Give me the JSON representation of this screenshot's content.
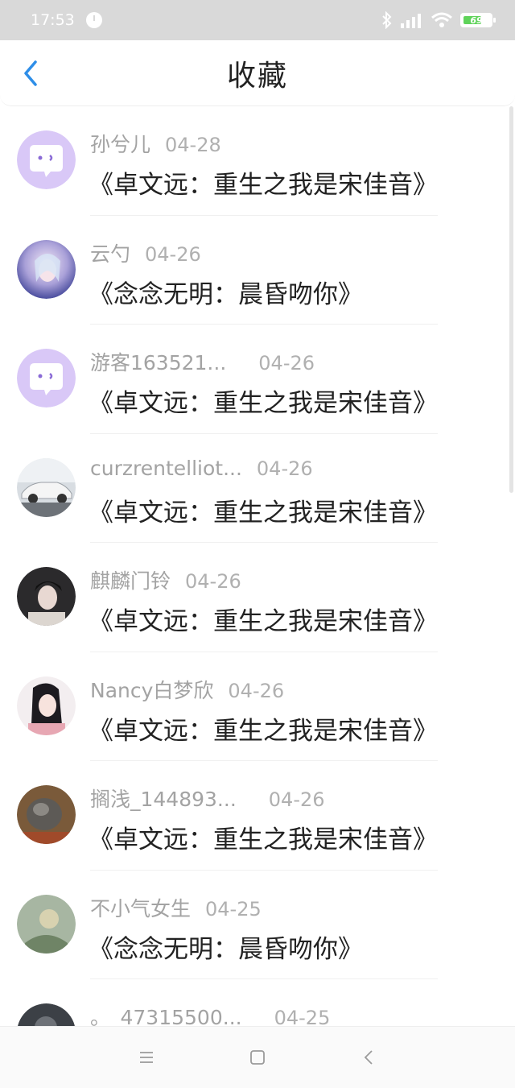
{
  "status_bar": {
    "time": "17:53",
    "battery": "69",
    "battery_level": 0.69
  },
  "header": {
    "title": "收藏"
  },
  "items": [
    {
      "user": "孙兮儿",
      "date": "04-28",
      "book": "《卓文远：重生之我是宋佳音》",
      "avatar": "default-avatar-icon"
    },
    {
      "user": "云勺",
      "date": "04-26",
      "book": "《念念无明：晨昏吻你》",
      "avatar": "fairy-avatar"
    },
    {
      "user": "游客163521...",
      "date": "04-26",
      "book": "《卓文远：重生之我是宋佳音》",
      "avatar": "default-avatar-icon"
    },
    {
      "user": "curzrentelliot...",
      "date": "04-26",
      "book": "《卓文远：重生之我是宋佳音》",
      "avatar": "car-avatar"
    },
    {
      "user": "麒麟门铃",
      "date": "04-26",
      "book": "《卓文远：重生之我是宋佳音》",
      "avatar": "portrait-avatar"
    },
    {
      "user": "Nancy白梦欣",
      "date": "04-26",
      "book": "《卓文远：重生之我是宋佳音》",
      "avatar": "illustration-avatar"
    },
    {
      "user": "搁浅_144893...",
      "date": "04-26",
      "book": "《卓文远：重生之我是宋佳音》",
      "avatar": "pet-avatar"
    },
    {
      "user": "不小气女生",
      "date": "04-25",
      "book": "《念念无明：晨昏吻你》",
      "avatar": "nature-avatar"
    },
    {
      "user": "。_47315500...",
      "date": "04-25",
      "book": "",
      "avatar": "dark-avatar"
    }
  ],
  "colors": {
    "accent": "#2e8ee8",
    "default_avatar": "#d9c8f7"
  }
}
